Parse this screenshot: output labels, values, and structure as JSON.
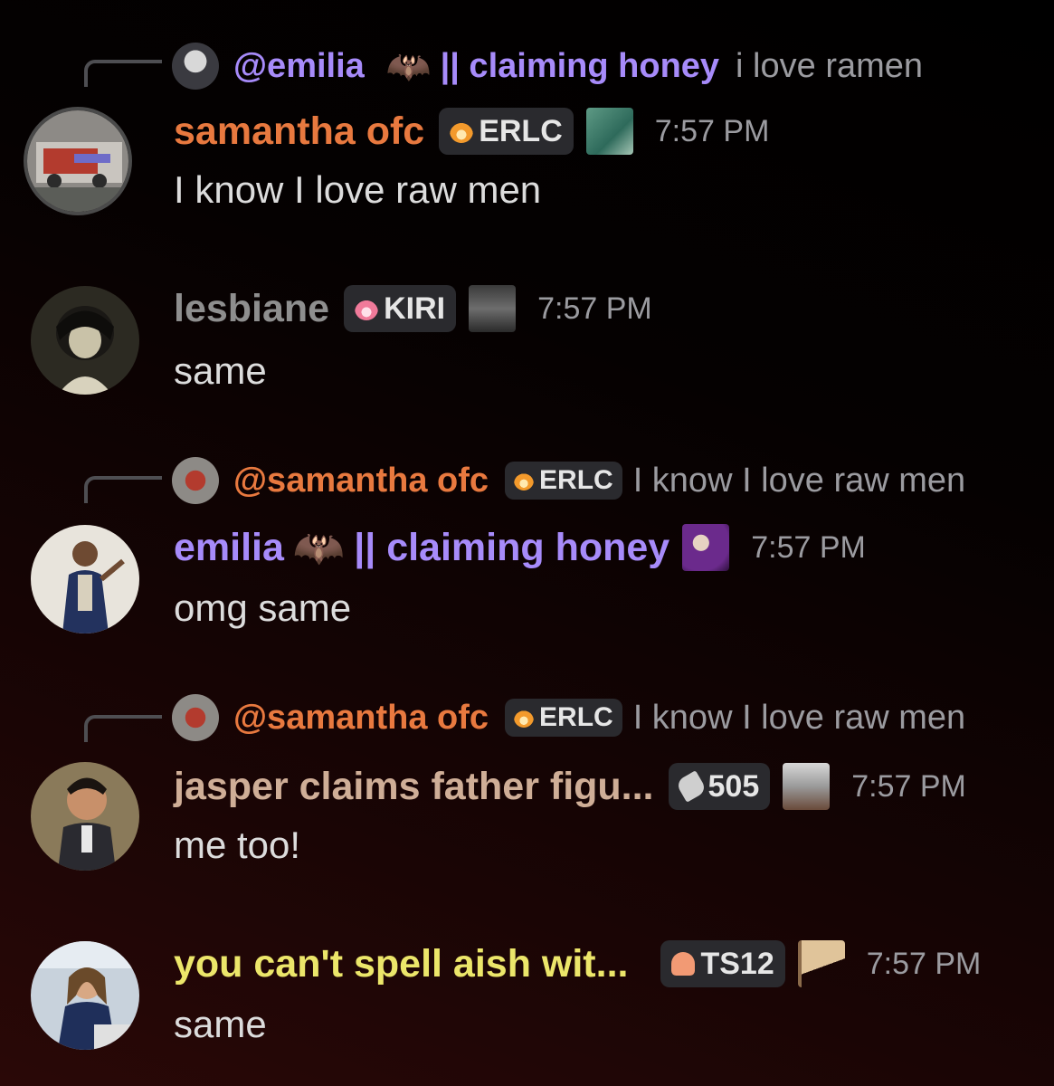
{
  "messages": [
    {
      "reply": {
        "name": "@emilia",
        "name_suffix": "|| claiming honey",
        "text": "i love ramen"
      },
      "author": "samantha ofc",
      "tag": "ERLC",
      "time": "7:57 PM",
      "content": "I know I love raw men"
    },
    {
      "author": "lesbiane",
      "tag": "KIRI",
      "time": "7:57 PM",
      "content": "same"
    },
    {
      "reply": {
        "name": "@samantha ofc",
        "tag": "ERLC",
        "text": "I know I love raw men"
      },
      "author": "emilia",
      "author_suffix": "|| claiming honey",
      "time": "7:57 PM",
      "content": "omg same"
    },
    {
      "reply": {
        "name": "@samantha ofc",
        "tag": "ERLC",
        "text": "I know I love raw men"
      },
      "author": "jasper claims father figu...",
      "tag": "505",
      "time": "7:57 PM",
      "content": "me too!"
    },
    {
      "author": "you can't spell aish wit...",
      "tag": "TS12",
      "time": "7:57 PM",
      "content": "same"
    }
  ],
  "colors": {
    "samantha": "#e8793f",
    "lesbiane": "#8e8e8e",
    "emilia": "#a78bfa",
    "jasper": "#cfae97",
    "aish": "#ece66a",
    "muted": "#9b9ba0",
    "text": "#dcdcdc"
  },
  "icons": {
    "erlc_tag": "flame-icon",
    "kiri_tag": "pink-flame-icon",
    "tag_505": "feather-icon",
    "ts12_tag": "heart-icon",
    "emilia_name": "bat-icon",
    "aish_role": "flag-icon"
  }
}
